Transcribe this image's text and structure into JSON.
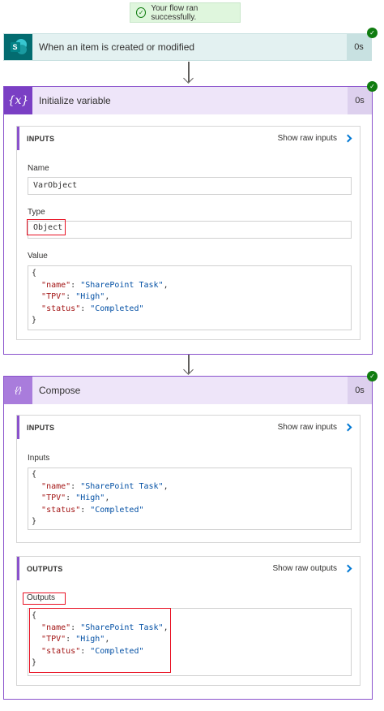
{
  "toast": {
    "text": "Your flow ran successfully."
  },
  "trigger": {
    "title": "When an item is created or modified",
    "duration": "0s",
    "icon": "sharepoint-icon"
  },
  "init_variable": {
    "title": "Initialize variable",
    "duration": "0s",
    "icon": "variable-icon",
    "inputs": {
      "label": "INPUTS",
      "show_raw": "Show raw inputs",
      "name_label": "Name",
      "name_value": "VarObject",
      "type_label": "Type",
      "type_value": "Object",
      "value_label": "Value",
      "value_lines": [
        "{",
        "  \"name\": \"SharePoint Task\",",
        "  \"TPV\": \"High\",",
        "  \"status\": \"Completed\"",
        "}"
      ]
    }
  },
  "compose": {
    "title": "Compose",
    "duration": "0s",
    "icon": "compose-icon",
    "inputs": {
      "label": "INPUTS",
      "show_raw": "Show raw inputs",
      "field_label": "Inputs",
      "lines": [
        "{",
        "  \"name\": \"SharePoint Task\",",
        "  \"TPV\": \"High\",",
        "  \"status\": \"Completed\"",
        "}"
      ]
    },
    "outputs": {
      "label": "OUTPUTS",
      "show_raw": "Show raw outputs",
      "field_label": "Outputs",
      "lines": [
        "{",
        "  \"name\": \"SharePoint Task\",",
        "  \"TPV\": \"High\",",
        "  \"status\": \"Completed\"",
        "}"
      ]
    }
  },
  "colors": {
    "success_green": "#107c10",
    "sharepoint_teal": "#036c70",
    "variable_purple": "#7a3fc4",
    "compose_purple": "#a97cdc",
    "highlight_red": "#e81123",
    "link_blue": "#0078d4"
  }
}
